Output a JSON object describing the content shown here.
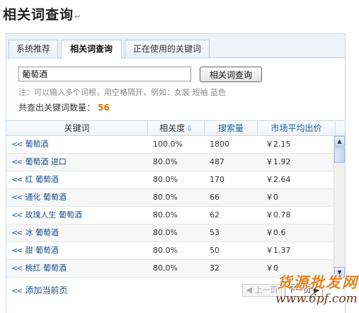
{
  "page": {
    "title": "相关词查询",
    "para_mark": "↵"
  },
  "tabs": [
    {
      "label": "系统推荐",
      "active": false
    },
    {
      "label": "相关词查询",
      "active": true
    },
    {
      "label": "正在使用的关键词",
      "active": false
    }
  ],
  "search": {
    "value": "葡萄酒",
    "placeholder": "",
    "button_label": "相关词查询"
  },
  "hint": "注：可以输入多个词根，用空格隔开，例如：女装 短袖 蓝色",
  "count": {
    "label": "共查出关键词数量：",
    "value": "56"
  },
  "table": {
    "headers": {
      "keyword": "关键词",
      "relevance": "相关度",
      "volume": "搜索量",
      "price": "市场平均出价"
    },
    "sort_icon": "sort-down-arrow-icon",
    "add_arrow": "<<",
    "rows": [
      {
        "keyword": "葡萄酒",
        "relevance": "100.0%",
        "volume": "1800",
        "price": "￥2.15"
      },
      {
        "keyword": "葡萄酒 进口",
        "relevance": "80.0%",
        "volume": "487",
        "price": "￥1.92"
      },
      {
        "keyword": "红 葡萄酒",
        "relevance": "80.0%",
        "volume": "170",
        "price": "￥2.64"
      },
      {
        "keyword": "通化 葡萄酒",
        "relevance": "80.0%",
        "volume": "66",
        "price": "￥0"
      },
      {
        "keyword": "玫瑰人生 葡萄酒",
        "relevance": "80.0%",
        "volume": "62",
        "price": "￥0.78"
      },
      {
        "keyword": "冰 葡萄酒",
        "relevance": "80.0%",
        "volume": "53",
        "price": "￥0.6"
      },
      {
        "keyword": "甜 葡萄酒",
        "relevance": "80.0%",
        "volume": "50",
        "price": "￥1.37"
      },
      {
        "keyword": "桃红 葡萄酒",
        "relevance": "80.0%",
        "volume": "32",
        "price": "￥0"
      }
    ]
  },
  "footer": {
    "add_page_arrow": "<<",
    "add_page_label": "添加当前页",
    "prev_label": "上一页",
    "next_label": "下一页"
  },
  "watermark": {
    "line1": "货源批发网",
    "line2": "www.6pf.com"
  },
  "colors": {
    "link": "#1a4f8a",
    "header_link": "#1a5fa8",
    "count_accent": "#e07000",
    "tab_border": "#b8c8da",
    "watermark_orange": "#e8841f"
  }
}
